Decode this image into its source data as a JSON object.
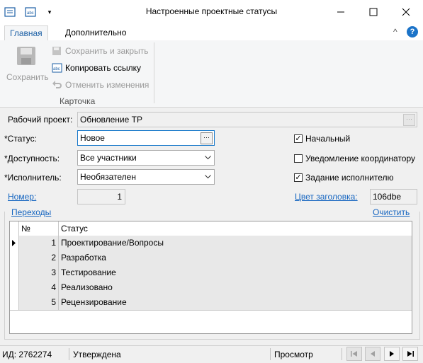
{
  "window": {
    "title": "Настроенные проектные статусы",
    "minimize": "—",
    "maximize": "☐",
    "close": "✕"
  },
  "ribbon": {
    "tabs": [
      "Главная",
      "Дополнительно"
    ],
    "save_label": "Сохранить",
    "save_close_label": "Сохранить и закрыть",
    "copy_link_label": "Копировать ссылку",
    "undo_label": "Отменить изменения",
    "group_label": "Карточка",
    "collapse_icon": "^",
    "help_icon": "?"
  },
  "form": {
    "project_label": "Рабочий проект:",
    "project_value": "Обновление TP",
    "status_label": "*Статус:",
    "status_value": "Новое",
    "availability_label": "*Доступность:",
    "availability_value": "Все участники",
    "executor_label": "*Исполнитель:",
    "executor_value": "Необязателен",
    "number_link": "Номер:",
    "number_value": "1",
    "header_color_link": "Цвет заголовка:",
    "header_color_value": "106dbe",
    "chk_initial_label": "Начальный",
    "chk_initial_checked": true,
    "chk_notify_label": "Уведомление координатору",
    "chk_notify_checked": false,
    "chk_task_label": "Задание исполнителю",
    "chk_task_checked": true,
    "transitions_link": "Переходы",
    "clear_link": "Очистить"
  },
  "grid": {
    "columns": [
      "№",
      "Статус"
    ],
    "rows": [
      {
        "num": "1",
        "status": "Проектирование/Вопросы"
      },
      {
        "num": "2",
        "status": "Разработка"
      },
      {
        "num": "3",
        "status": "Тестирование"
      },
      {
        "num": "4",
        "status": "Реализовано"
      },
      {
        "num": "5",
        "status": "Рецензирование"
      }
    ]
  },
  "statusbar": {
    "id_text": "ИД: 2762274",
    "state_text": "Утверждена",
    "mode_text": "Просмотр"
  }
}
